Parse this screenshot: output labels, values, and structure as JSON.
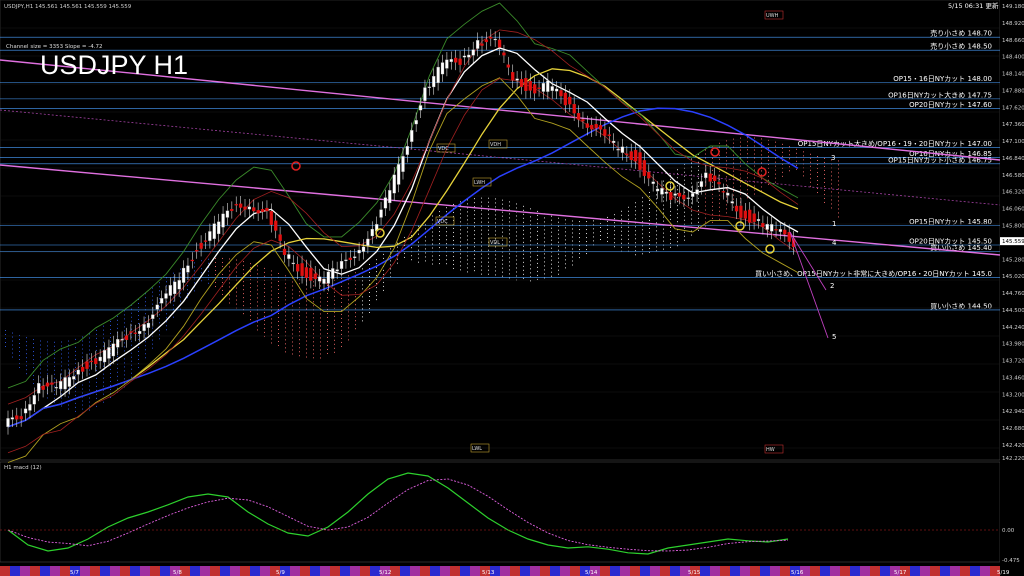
{
  "header": {
    "symbol_line": "USDJPY,H1  145.561 145.561 145.559 145.559",
    "title": "USDJPY H1",
    "channel_info": "Channel size = 3353 Slope = -4.72",
    "datetime": "5/15 06:31 更新",
    "sub_title": "H1  macd (12)"
  },
  "chart_data": {
    "type": "line",
    "title": "USDJPY H1",
    "ylim": [
      142.22,
      149.18
    ],
    "grid": true,
    "price_ticks": [
      "149.180",
      "148.920",
      "148.660",
      "148.400",
      "148.140",
      "147.880",
      "147.620",
      "147.360",
      "147.100",
      "146.840",
      "146.580",
      "146.320",
      "146.060",
      "145.800",
      "145.540",
      "145.280",
      "145.020",
      "144.760",
      "144.500",
      "144.240",
      "143.980",
      "143.720",
      "143.460",
      "143.200",
      "142.940",
      "142.680",
      "142.420",
      "142.220"
    ],
    "x_dates": [
      "5/7",
      "5/8",
      "5/9",
      "5/12",
      "5/13",
      "5/14",
      "5/15",
      "5/16",
      "5/17",
      "5/19"
    ],
    "current_price": "145.559",
    "price_levels": [
      {
        "price": 148.7,
        "text": "売り小さめ 148.70"
      },
      {
        "price": 148.5,
        "text": "売り小さめ 148.50"
      },
      {
        "price": 148.0,
        "text": "OP15・16日NYカット 148.00"
      },
      {
        "price": 147.75,
        "text": "OP16日NYカット大きめ 147.75"
      },
      {
        "price": 147.6,
        "text": "OP20日NYカット 147.60"
      },
      {
        "price": 147.0,
        "text": "OP15日NYカット大きめ/OP16・19・20日NYカット 147.00"
      },
      {
        "price": 146.85,
        "text": "OP16日NYカット 146.85"
      },
      {
        "price": 146.75,
        "text": "OP15日NYカット小さめ 146.75"
      },
      {
        "price": 145.8,
        "text": "OP15日NYカット 145.80"
      },
      {
        "price": 145.5,
        "text": "OP20日NYカット 145.50"
      },
      {
        "price": 145.4,
        "text": "買い小さめ 145.40"
      },
      {
        "price": 145.0,
        "text": "買い小さめ、OP15日NYカット非常に大きめ/OP16・20日NYカット 145.0"
      },
      {
        "price": 144.5,
        "text": "買い小さめ 144.50"
      }
    ],
    "close_series": [
      142.7,
      142.9,
      143.35,
      143.25,
      143.55,
      143.7,
      143.85,
      144.1,
      144.3,
      144.6,
      145.0,
      145.45,
      145.75,
      146.05,
      146.15,
      145.95,
      145.35,
      145.1,
      144.95,
      145.1,
      145.4,
      145.7,
      146.3,
      147.1,
      147.9,
      148.25,
      148.35,
      148.65,
      148.6,
      148.1,
      147.9,
      147.95,
      147.7,
      147.45,
      147.2,
      147.0,
      146.85,
      146.4,
      146.2,
      146.3,
      146.55,
      146.3,
      146.0,
      145.85,
      145.7,
      145.55
    ],
    "wave_labels": [
      "1",
      "2",
      "3",
      "4",
      "5"
    ],
    "box_labels": [
      "VDC",
      "VDH",
      "LWH",
      "VDL",
      "VDC",
      "LWL",
      "UWH",
      "HW"
    ],
    "macd_ticks": [
      "0.00",
      "-0.475"
    ]
  }
}
